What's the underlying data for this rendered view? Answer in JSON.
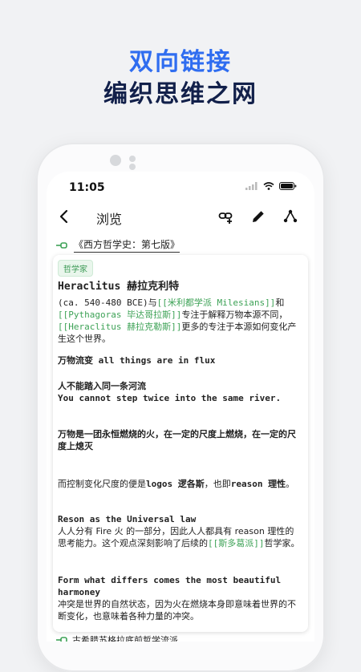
{
  "promo": {
    "line1": "双向链接",
    "line2": "编织思维之网"
  },
  "status": {
    "time": "11:05"
  },
  "appbar": {
    "title": "浏览"
  },
  "breadcrumb": {
    "book": "《西方哲学史：第七版》"
  },
  "card": {
    "badge": "哲学家",
    "heading": "Heraclitus 赫拉克利特",
    "p1_a": "(ca. 540-480 BCE)与",
    "p1_link1": "[[米利都学派 Milesians]]",
    "p1_b": "和",
    "p1_link2": "[[Pythagoras 毕达哥拉斯]]",
    "p1_c": "专注于解释万物本源不同，",
    "p1_link3": "[[Heraclitus 赫拉克勒斯]]",
    "p1_d": "更多的专注于本源如何变化产生这个世界。",
    "flux": "万物流变 all things are in flux",
    "river_cn": "人不能踏入同一条河流",
    "river_en": "You cannot step twice into the same river.",
    "fire": "万物是一团永恒燃烧的火，在一定的尺度上燃烧，在一定的尺度上熄灭",
    "logos_a": "而控制变化尺度的便是",
    "logos_b": "logos 逻各斯",
    "logos_c": "，也即",
    "logos_d": "reason 理性",
    "logos_e": "。",
    "reason_title": "Reson as the Universal law",
    "reason_a": "人人分有 Fire 火 的一部分，因此人人都具有 reason 理性的思考能力。这个观点深刻影响了后续的",
    "reason_link": "[[斯多葛派]]",
    "reason_b": "哲学家。",
    "form_title": "Form what differs comes the most beautiful harmoney",
    "form_text": "冲突是世界的自然状态，因为火在燃烧本身即意味着世界的不断变化，也意味着各种力量的冲突。"
  },
  "bottom": {
    "label": "古希腊苏格拉底前哲学流派"
  },
  "colors": {
    "accent_blue": "#2f6df0",
    "link_green": "#3da256",
    "navy": "#12204a"
  },
  "icons": [
    "back-arrow-icon",
    "link-add-icon",
    "edit-pencil-icon",
    "graph-share-icon",
    "signal-icon",
    "wifi-icon",
    "battery-icon",
    "link-icon"
  ]
}
